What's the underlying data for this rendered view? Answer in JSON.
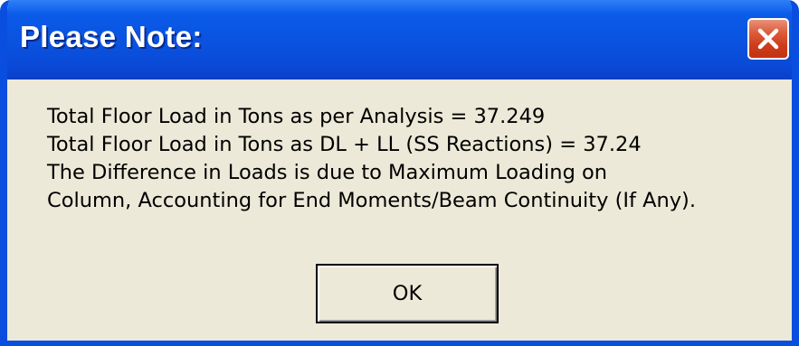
{
  "dialog": {
    "title": "Please Note:",
    "close_icon": "close-icon",
    "message_lines": [
      "Total Floor Load in Tons as per Analysis = 37.249",
      "Total Floor Load in Tons as DL + LL (SS Reactions) = 37.24",
      "The Difference in Loads is due to Maximum Loading on",
      "Column, Accounting for End Moments/Beam Continuity (If Any)."
    ],
    "ok_label": "OK",
    "colors": {
      "title_bar": "#0a52e0",
      "body": "#ece9d8",
      "close_button": "#cc3b1a",
      "title_text": "#ffffff"
    }
  }
}
